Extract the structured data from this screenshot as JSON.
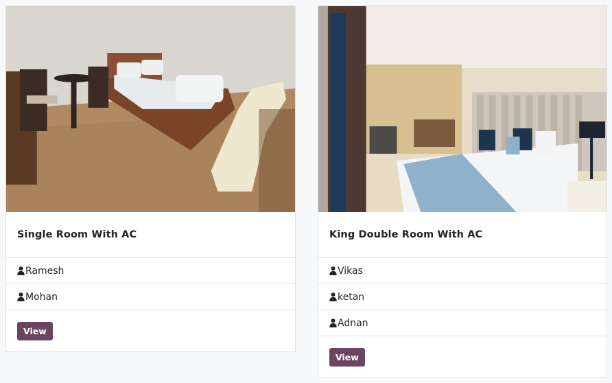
{
  "rooms": [
    {
      "title": "Single Room With AC",
      "guests": [
        "Ramesh",
        "Mohan"
      ],
      "view_label": "View"
    },
    {
      "title": "King Double Room With AC",
      "guests": [
        "Vikas",
        "ketan",
        "Adnan"
      ],
      "view_label": "View"
    }
  ],
  "icons": {
    "guest": "user-icon"
  },
  "colors": {
    "button": "#6b4462",
    "border": "#dcdfe3",
    "background": "#f7f8fa"
  }
}
